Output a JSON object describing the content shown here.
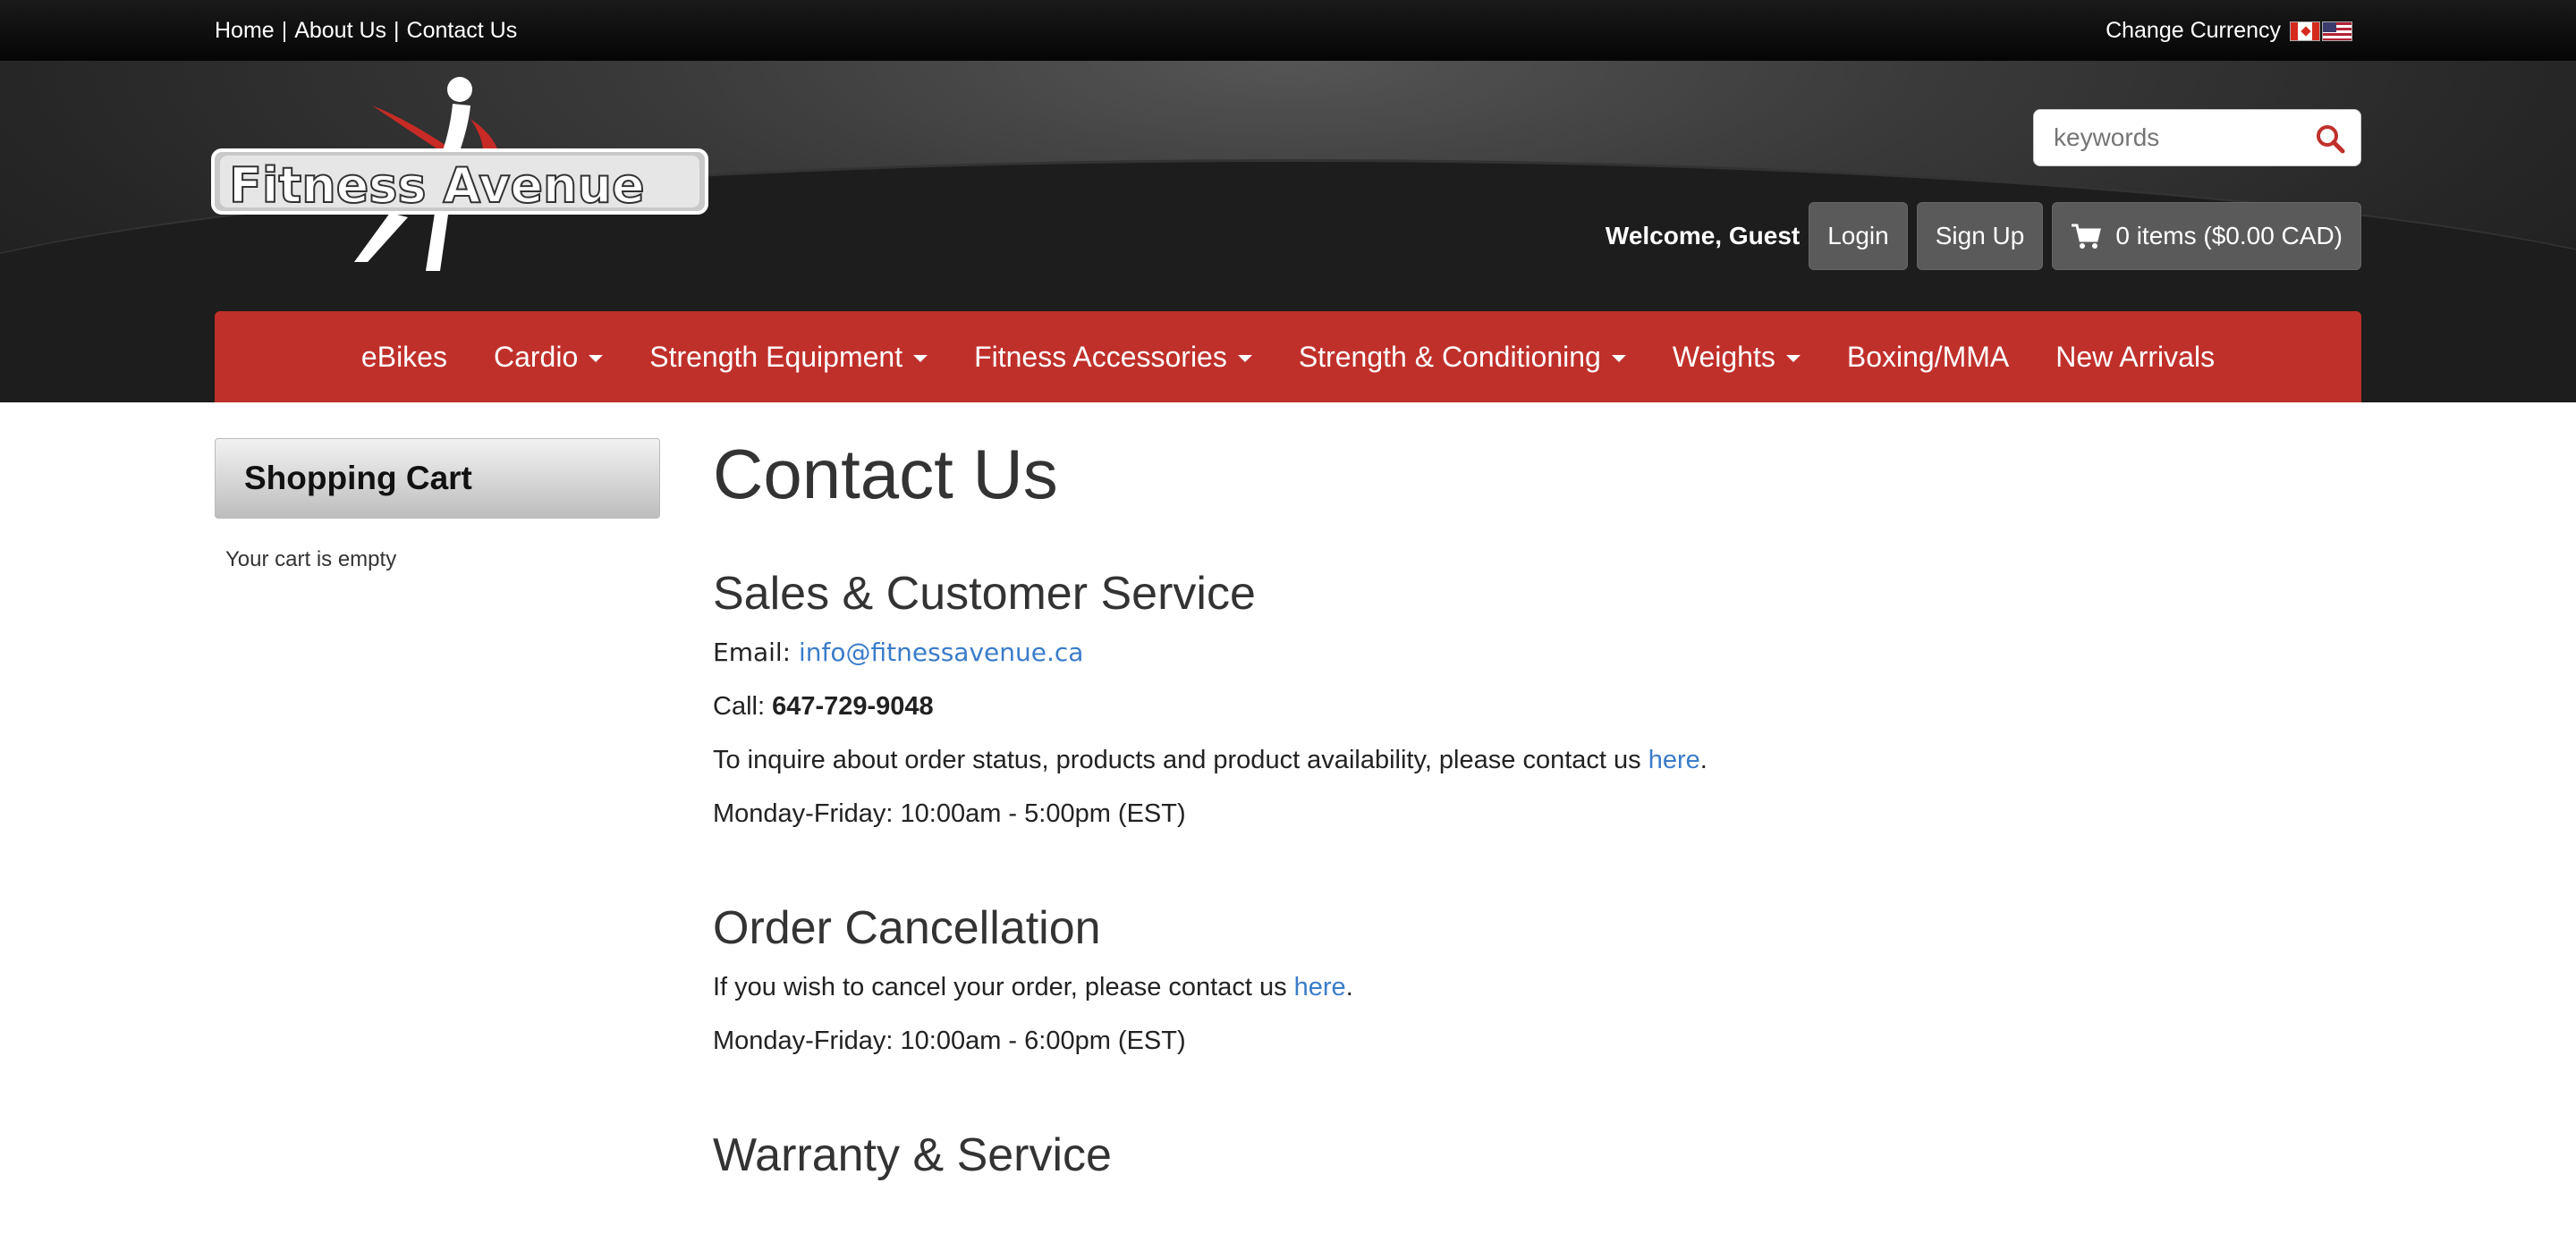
{
  "topbar": {
    "links": [
      "Home",
      "About Us",
      "Contact Us"
    ],
    "separator": "|",
    "currency_label": "Change Currency"
  },
  "header": {
    "logo_text": "Fitness Avenue",
    "search_placeholder": "keywords",
    "welcome": "Welcome, Guest",
    "login": "Login",
    "signup": "Sign Up",
    "cart": "0 items ($0.00 CAD)"
  },
  "nav": {
    "items": [
      {
        "label": "eBikes",
        "dropdown": false
      },
      {
        "label": "Cardio",
        "dropdown": true
      },
      {
        "label": "Strength Equipment",
        "dropdown": true
      },
      {
        "label": "Fitness Accessories",
        "dropdown": true
      },
      {
        "label": "Strength & Conditioning",
        "dropdown": true
      },
      {
        "label": "Weights",
        "dropdown": true
      },
      {
        "label": "Boxing/MMA",
        "dropdown": false
      },
      {
        "label": "New Arrivals",
        "dropdown": false
      }
    ]
  },
  "sidebar": {
    "title": "Shopping Cart",
    "empty_text": "Your cart is empty"
  },
  "main": {
    "title": "Contact Us",
    "sales": {
      "heading": "Sales & Customer Service",
      "email_label": "Email:",
      "email": "info@fitnessavenue.ca",
      "call_label": "Call:",
      "phone": "647-729-9048",
      "inquire_text": "To inquire about order status, products and product availability, please contact us",
      "here": "here",
      "hours": "Monday-Friday: 10:00am - 5:00pm (EST)"
    },
    "cancel": {
      "heading": "Order Cancellation",
      "text": "If you wish to cancel your order, please contact us",
      "here": "here",
      "hours": "Monday-Friday: 10:00am - 6:00pm (EST)"
    },
    "warranty": {
      "heading": "Warranty & Service"
    }
  },
  "colors": {
    "nav_red": "#c0302b",
    "link_blue": "#3a7cc9",
    "button_gray": "#5a5a5a"
  }
}
